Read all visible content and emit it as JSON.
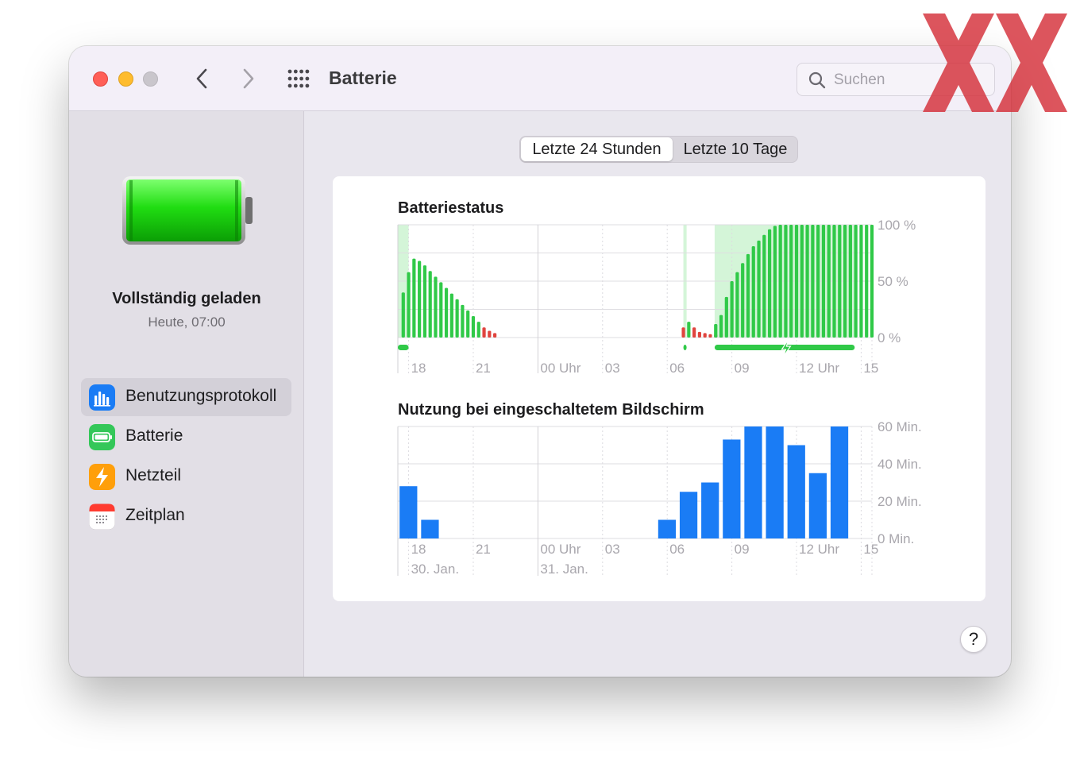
{
  "window": {
    "title": "Batterie",
    "search_placeholder": "Suchen"
  },
  "sidebar": {
    "status_title": "Vollständig geladen",
    "status_time": "Heute, 07:00",
    "items": [
      {
        "label": "Benutzungsprotokoll",
        "icon": "bar-chart-icon",
        "color": "#1a7cf5",
        "selected": true
      },
      {
        "label": "Batterie",
        "icon": "battery-icon",
        "color": "#34c759",
        "selected": false
      },
      {
        "label": "Netzteil",
        "icon": "lightning-bolt-icon",
        "color": "#ff9500",
        "selected": false
      },
      {
        "label": "Zeitplan",
        "icon": "calendar-icon",
        "color": "#ff3b30",
        "selected": false
      }
    ]
  },
  "segmented": {
    "options": [
      "Letzte 24 Stunden",
      "Letzte 10 Tage"
    ],
    "selected": 0
  },
  "help_label": "?",
  "colors": {
    "battery_green": "#30c948",
    "battery_red": "#e0443e",
    "charging_band": "#d4f5d8",
    "screen_blue": "#1a7cf5"
  },
  "chart_data": [
    {
      "type": "bar",
      "title": "Batteriestatus",
      "y_tick_labels": [
        "100 %",
        "50 %",
        "0 %"
      ],
      "ylim": [
        0,
        100
      ],
      "x_tick_labels": [
        "18",
        "21",
        "00 Uhr",
        "03",
        "06",
        "09",
        "12 Uhr",
        "15"
      ],
      "x_range_hours": [
        17.5,
        15.5
      ],
      "bar_interval_minutes": 15,
      "segments": [
        {
          "start_hour": 17.75,
          "values": [
            40,
            58,
            70,
            68,
            64,
            59,
            54,
            49,
            44,
            39,
            34,
            29,
            24,
            19,
            14,
            9,
            6,
            4
          ],
          "low_values_red": true
        },
        {
          "start_hour": 6.75,
          "values": [
            9,
            14,
            9,
            5,
            4,
            3,
            3,
            4
          ]
        },
        {
          "start_hour": 8.25,
          "values": [
            12,
            20,
            36,
            50,
            58,
            66,
            74,
            81,
            86,
            91,
            96,
            99,
            100,
            100,
            100,
            100,
            100,
            100,
            100,
            100,
            100,
            100,
            100,
            100,
            100,
            100,
            100,
            100,
            100,
            100
          ]
        }
      ],
      "charging_periods_hours": [
        [
          17.5,
          18.0
        ],
        [
          6.75,
          6.9
        ],
        [
          8.2,
          14.7
        ]
      ],
      "legend_icon": "charging-bolt-icon"
    },
    {
      "type": "bar",
      "title": "Nutzung bei eingeschaltetem Bildschirm",
      "y_tick_labels": [
        "60 Min.",
        "40 Min.",
        "20 Min.",
        "0 Min."
      ],
      "ylim": [
        0,
        60
      ],
      "x_tick_labels": [
        "18",
        "21",
        "00 Uhr",
        "03",
        "06",
        "09",
        "12 Uhr",
        "15"
      ],
      "date_labels": [
        "30. Jan.",
        "31. Jan."
      ],
      "x_range_hours": [
        17.5,
        15.5
      ],
      "bar_start_hours": [
        17.5,
        18.5,
        5.5,
        6.5,
        7.5,
        8.5,
        9.5,
        10.5,
        11.5,
        12.5,
        13.5
      ],
      "values": [
        28,
        10,
        10,
        25,
        30,
        53,
        60,
        60,
        50,
        35,
        60
      ]
    }
  ]
}
